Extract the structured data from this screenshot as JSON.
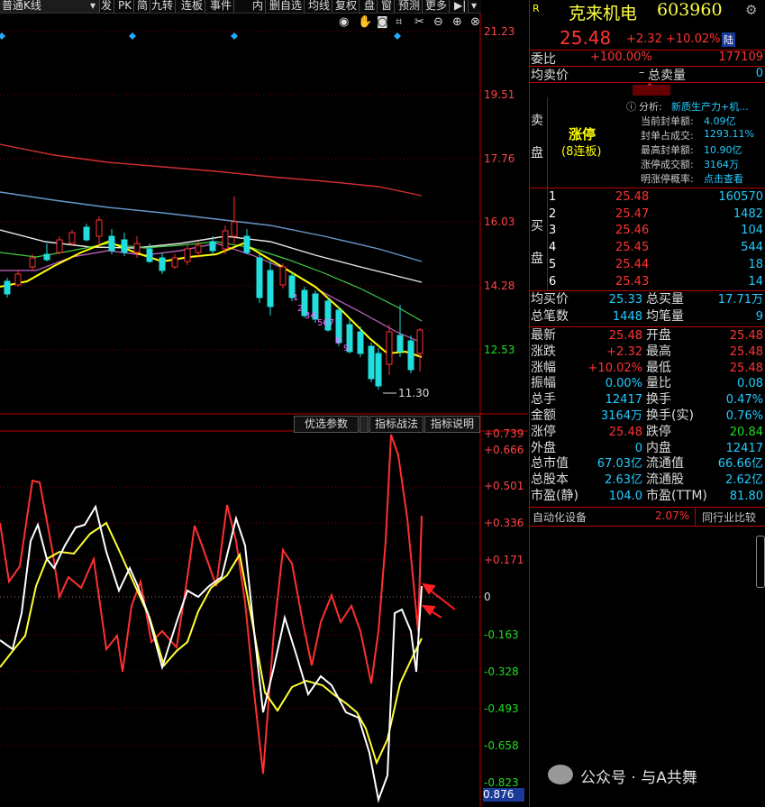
{
  "toolbar": {
    "period_select": "普通K线",
    "buttons": [
      "发",
      "PK",
      "简",
      "九转",
      "连板",
      "事件",
      "内",
      "删自选",
      "均线",
      "复权",
      "盘",
      "窗",
      "预测",
      "更多"
    ]
  },
  "price_axis": [
    "21.23",
    "19.51",
    "17.76",
    "16.03",
    "14.28",
    "12.53"
  ],
  "low_label": "11.30",
  "ma_numbers": [
    "1",
    "2",
    "34",
    "567",
    "8",
    "9"
  ],
  "osc_tabs": {
    "params": "优选参数",
    "tactics": "指标战法",
    "help": "指标说明"
  },
  "osc_axis": [
    "+0.739",
    "+0.666",
    "+0.501",
    "+0.336",
    "+0.171",
    "0",
    "-0.163",
    "-0.328",
    "-0.493",
    "-0.658",
    "-0.823"
  ],
  "osc_current": "0.876",
  "watermark": "公众号 · 与A共舞",
  "stock": {
    "badge": "R",
    "name": "克来机电",
    "code": "603960",
    "price": "25.48",
    "change": "+2.32",
    "pct": "+10.02%",
    "exchange": "陆"
  },
  "weibi": {
    "label": "委比",
    "pct": "+100.00%",
    "diff": "177109"
  },
  "junmai": {
    "label": "均卖价",
    "dash": "–",
    "zongmai": "总卖量",
    "value": "0"
  },
  "sell_side": {
    "label1": "卖",
    "label2": "盘",
    "limit_up": "涨停",
    "streak": "(8连板)"
  },
  "analysis": {
    "label": "分析:",
    "topic": "新质生产力+机...",
    "rows": [
      {
        "k": "当前封单额:",
        "v": "4.09亿"
      },
      {
        "k": "封单占成交:",
        "v": "1293.11%"
      },
      {
        "k": "最高封单额:",
        "v": "10.90亿"
      },
      {
        "k": "涨停成交额:",
        "v": "3164万"
      },
      {
        "k": "明涨停概率:",
        "v": "点击查看"
      }
    ]
  },
  "buy_side": {
    "label1": "买",
    "label2": "盘"
  },
  "bids": [
    {
      "n": "1",
      "price": "25.48",
      "vol": "160570"
    },
    {
      "n": "2",
      "price": "25.47",
      "vol": "1482"
    },
    {
      "n": "3",
      "price": "25.46",
      "vol": "104"
    },
    {
      "n": "4",
      "price": "25.45",
      "vol": "544"
    },
    {
      "n": "5",
      "price": "25.44",
      "vol": "18"
    },
    {
      "n": "6",
      "price": "25.43",
      "vol": "14"
    }
  ],
  "summary1": [
    {
      "l": "均买价",
      "v": "25.33",
      "l2": "总买量",
      "v2": "17.71万"
    },
    {
      "l": "总笔数",
      "v": "1448",
      "l2": "均笔量",
      "v2": "9"
    }
  ],
  "stats": [
    {
      "l": "最新",
      "v": "25.48",
      "l2": "开盘",
      "v2": "25.48"
    },
    {
      "l": "涨跌",
      "v": "+2.32",
      "l2": "最高",
      "v2": "25.48"
    },
    {
      "l": "涨幅",
      "v": "+10.02%",
      "l2": "最低",
      "v2": "25.48"
    },
    {
      "l": "振幅",
      "v": "0.00%",
      "l2": "量比",
      "v2": "0.08"
    },
    {
      "l": "总手",
      "v": "12417",
      "l2": "换手",
      "v2": "0.47%"
    },
    {
      "l": "金额",
      "v": "3164万",
      "l2": "换手(实)",
      "v2": "0.76%"
    },
    {
      "l": "涨停",
      "v": "25.48",
      "l2": "跌停",
      "v2": "20.84"
    },
    {
      "l": "外盘",
      "v": "0",
      "l2": "内盘",
      "v2": "12417"
    },
    {
      "l": "总市值",
      "v": "67.03亿",
      "l2": "流通值",
      "v2": "66.66亿"
    },
    {
      "l": "总股本",
      "v": "2.63亿",
      "l2": "流通股",
      "v2": "2.62亿"
    },
    {
      "l": "市盈(静)",
      "v": "104.0",
      "l2": "市盈(TTM)",
      "v2": "81.80"
    }
  ],
  "industry": {
    "name": "自动化设备",
    "pct": "2.07%",
    "compare": "同行业比较"
  },
  "colors": {
    "up": "#ff3333",
    "down": "#22dd22",
    "cyan": "#22ccff",
    "yellow": "#ffff00",
    "bg": "#000000"
  }
}
